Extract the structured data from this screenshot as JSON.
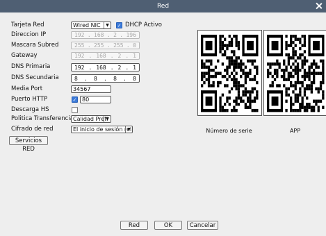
{
  "window": {
    "title": "Red"
  },
  "form": {
    "nic_label": "Tarjeta Red",
    "nic_value": "Wired NIC",
    "dhcp_label": "DHCP Activo",
    "ip_label": "Direccion IP",
    "ip": [
      "192",
      "168",
      "2",
      "196"
    ],
    "mask_label": "Mascara Subred",
    "mask": [
      "255",
      "255",
      "255",
      "0"
    ],
    "gateway_label": "Gateway",
    "gateway": [
      "192",
      "168",
      "2",
      "1"
    ],
    "dns1_label": "DNS Primaria",
    "dns1": [
      "192",
      "168",
      "2",
      "1"
    ],
    "dns2_label": "DNS Secundaria",
    "dns2": [
      "8",
      "8",
      "8",
      "8"
    ],
    "media_port_label": "Media Port",
    "media_port_value": "34567",
    "http_port_label": "Puerto HTTP",
    "http_port_value": "80",
    "hs_label": "Descarga HS",
    "policy_label": "Politica Transferencia",
    "policy_value": "Calidad Prefi",
    "encryption_label": "Cifrado de red",
    "encryption_value": "El inicio de sesión rei",
    "services_button": "Servicios RED"
  },
  "qr": {
    "serial_caption": "Número de serie",
    "app_caption": "APP"
  },
  "buttons": {
    "red": "Red",
    "ok": "OK",
    "cancel": "Cancelar"
  }
}
